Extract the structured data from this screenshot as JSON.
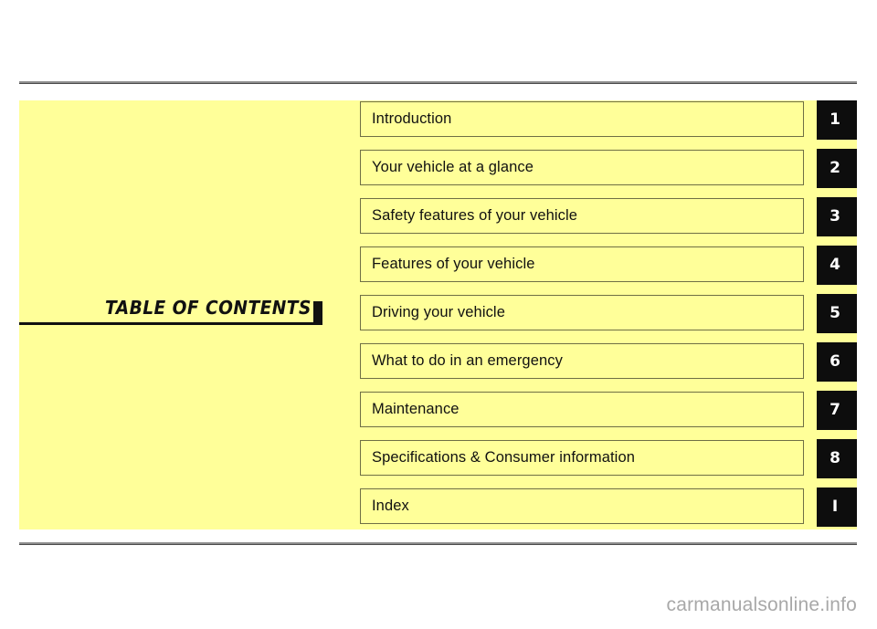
{
  "document": {
    "title": "TABLE  OF  CONTENTS",
    "watermark": "carmanualsonline.info"
  },
  "contents": {
    "entries": [
      {
        "label": "Introduction",
        "tab": "1"
      },
      {
        "label": "Your vehicle at a glance",
        "tab": "2"
      },
      {
        "label": "Safety features of your vehicle",
        "tab": "3"
      },
      {
        "label": "Features of your vehicle",
        "tab": "4"
      },
      {
        "label": "Driving your vehicle",
        "tab": "5"
      },
      {
        "label": "What to do in an emergency",
        "tab": "6"
      },
      {
        "label": "Maintenance",
        "tab": "7"
      },
      {
        "label": "Specifications & Consumer information",
        "tab": "8"
      },
      {
        "label": "Index",
        "tab": "I"
      }
    ]
  },
  "colors": {
    "panel_background": "#ffff99",
    "tab_background": "#0d0d0d",
    "tab_text": "#ffffff",
    "box_border": "#6f6f45",
    "rule": "#8d8d8d",
    "text": "#111111",
    "watermark": "#a8a8a8"
  }
}
